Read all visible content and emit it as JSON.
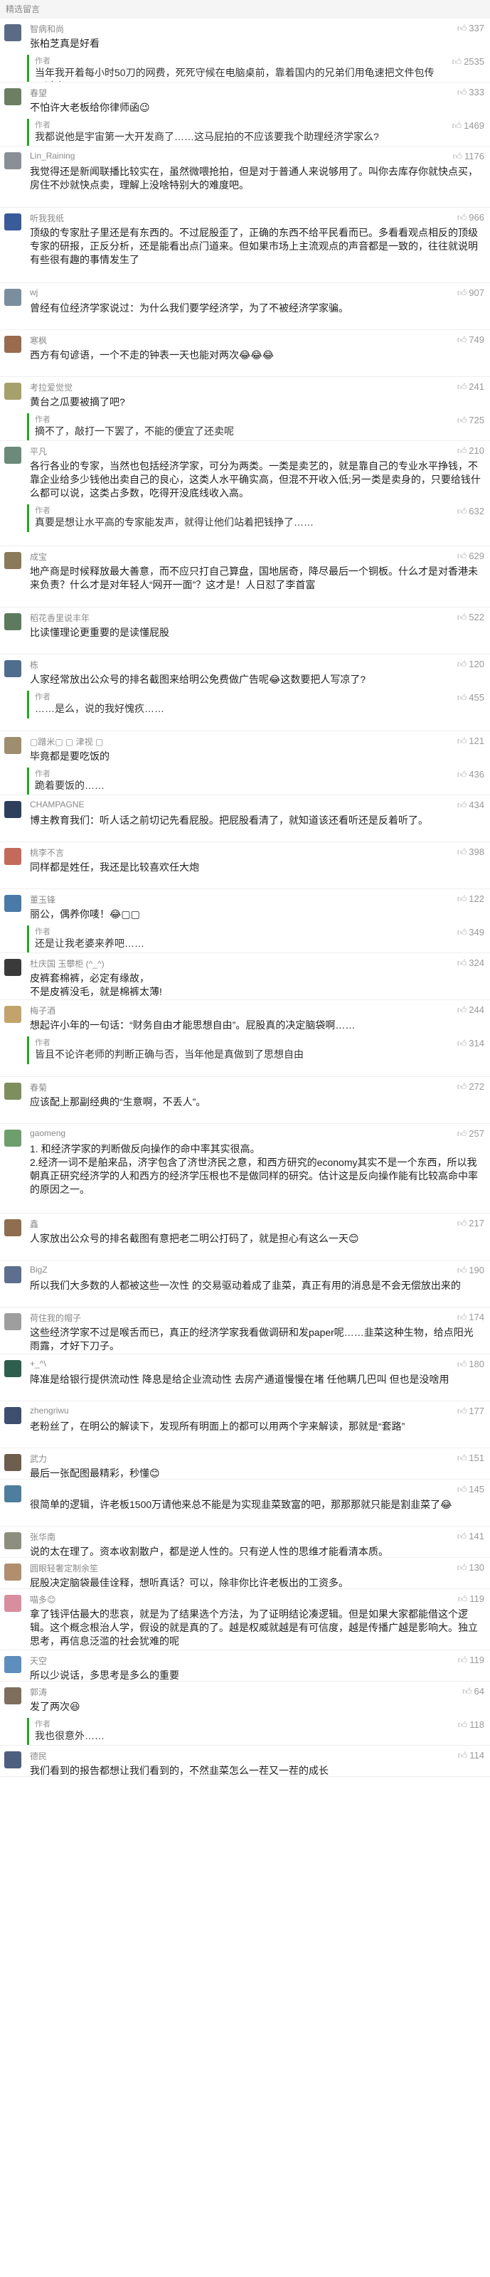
{
  "header": {
    "title": "精选留言"
  },
  "comments": [
    {
      "user": "智病和尚",
      "avatar_color": "#5b6b85",
      "likes": "337",
      "text": "张柏芝真是好看",
      "reply": {
        "label": "作者",
        "text": "当年我开着每小时50刀的网费，死死守候在电脑桌前，靠着国内的兄弟们用龟速把文件包传了过来……",
        "likes": "2535"
      }
    },
    {
      "user": "春望",
      "avatar_color": "#6d7f63",
      "likes": "333",
      "text": "不怕许大老板给你律师函😉",
      "reply": {
        "label": "作者",
        "text": "我都说他是宇宙第一大开发商了……这马屁拍的不应该要我个助理经济学家么?",
        "likes": "1469"
      }
    },
    {
      "user": "Lin_Raining",
      "avatar_color": "#8a8f96",
      "likes": "1176",
      "text": "我觉得还是新闻联播比较实在，虽然微喂抢拍，但是对于普通人来说够用了。叫你去库存你就快点买，房住不炒就快点卖，理解上没啥特别大的难度吧。"
    },
    {
      "user": "听我我纸",
      "avatar_color": "#3a5b9a",
      "likes": "966",
      "text": "顶级的专家肚子里还是有东西的。不过屁股歪了，正确的东西不给平民看而已。多看看观点相反的顶级专家的研报，正反分析，还是能看出点门道来。但如果市场上主流观点的声音都是一致的，往往就说明有些很有趣的事情发生了"
    },
    {
      "user": "wj",
      "avatar_color": "#7a8e9e",
      "likes": "907",
      "text": "曾经有位经济学家说过：为什么我们要学经济学，为了不被经济学家骗。"
    },
    {
      "user": "寒枫",
      "avatar_color": "#9a6b4f",
      "likes": "749",
      "text": "西方有句谚语，一个不走的钟表一天也能对两次😂😂😂"
    },
    {
      "user": "考拉爱觉觉",
      "avatar_color": "#a6a06b",
      "likes": "241",
      "text": "黄台之瓜要被摘了吧?",
      "reply": {
        "label": "作者",
        "text": "摘不了，敲打一下罢了，不能的便宜了还卖呢",
        "likes": "725"
      }
    },
    {
      "user": "平凡",
      "avatar_color": "#6b8a7a",
      "likes": "210",
      "text": "各行各业的专家，当然也包括经济学家，可分为两类。一类是卖艺的，就是靠自己的专业水平挣钱，不靠企业给多少钱他出卖自己的良心，这类人水平确实高，但混不开收入低;另一类是卖身的，只要给钱什么都可以说，这类占多数，吃得开没底线收入高。",
      "reply": {
        "label": "作者",
        "text": "真要是想让水平高的专家能发声，就得让他们站着把钱挣了……",
        "likes": "632"
      }
    },
    {
      "user": "成宝",
      "avatar_color": "#8a7a5a",
      "likes": "629",
      "text": "地产商是时候释放最大善意，而不应只打自己算盘，国地居奇，降尽最后一个铜板。什么才是对香港未来负责？什么才是对年轻人“网开一面”？这才是！人日怼了李首富"
    },
    {
      "user": "稻花香里说丰年",
      "avatar_color": "#5e7a5e",
      "likes": "522",
      "text": "比读懂理论更重要的是读懂屁股"
    },
    {
      "user": "栋",
      "avatar_color": "#4f6e8e",
      "likes": "120",
      "text": "人家经常放出公众号的排名截图来给明公免费做广告呢😂这数要把人写凉了?",
      "reply": {
        "label": "作者",
        "text": "……是么，说的我好愧疚……",
        "likes": "455"
      }
    },
    {
      "user": "▢蹭米▢ ▢ 津视 ▢",
      "avatar_color": "#9e8e6e",
      "likes": "121",
      "text": "毕竟都是要吃饭的",
      "reply": {
        "label": "作者",
        "text": "跪着要饭的……",
        "likes": "436"
      }
    },
    {
      "user": "CHAMPAGNE",
      "avatar_color": "#2e3f5e",
      "likes": "434",
      "text": "博主教育我们：听人话之前切记先看屁股。把屁股看清了，就知道该还看听还是反着听了。"
    },
    {
      "user": "桃李不言",
      "avatar_color": "#c46a5a",
      "likes": "398",
      "text": "同样都是姓任，我还是比较喜欢任大炮"
    },
    {
      "user": "董玉锋",
      "avatar_color": "#4a7aa8",
      "likes": "122",
      "text": "丽公，偶养你唛！😂▢▢",
      "reply": {
        "label": "作者",
        "text": "还是让我老婆来养吧……",
        "likes": "349"
      }
    },
    {
      "user": "杜庆国 玉攀柜 (^_^)",
      "avatar_color": "#3a3a3a",
      "likes": "324",
      "text": "皮裤套棉裤，必定有缘故，\n不是皮裤没毛，就是棉裤太薄!"
    },
    {
      "user": "梅子酒",
      "avatar_color": "#c2a36b",
      "likes": "244",
      "text": "想起许小年的一句话：“财务自由才能思想自由”。屁股真的决定脑袋啊……",
      "reply": {
        "label": "作者",
        "text": "皆且不论许老师的判断正确与否，当年他是真做到了思想自由",
        "likes": "314"
      }
    },
    {
      "user": "春菊",
      "avatar_color": "#7e8e5e",
      "likes": "272",
      "text": "应该配上那副经典的“生意啊，不丢人”。"
    },
    {
      "user": "gaomeng",
      "avatar_color": "#6e9e6e",
      "likes": "257",
      "text": "1. 和经济学家的判断做反向操作的命中率其实很高。\n2.经济一词不是舶来品，济字包含了济世济民之意，和西方研究的economy其实不是一个东西，所以我朝真正研究经济学的人和西方的经济学压根也不是做同样的研究。估计这是反向操作能有比较高命中率的原因之一。"
    },
    {
      "user": "鑫",
      "avatar_color": "#8e6e4e",
      "likes": "217",
      "text": "人家放出公众号的排名截图有意把老二明公打码了，就是担心有这么一天😊"
    },
    {
      "user": "BigZ",
      "avatar_color": "#5e6e8e",
      "likes": "190",
      "text": "所以我们大多数的人都被这些一次性 的交易驱动着成了韭菜，真正有用的消息是不会无偿放出来的"
    },
    {
      "user": "荷住我的帽子",
      "avatar_color": "#9e9e9e",
      "likes": "174",
      "text": "这些经济学家不过是喉舌而已，真正的经济学家我看做调研和发paper呢……韭菜这种生物，给点阳光雨露，才好下刀子。"
    },
    {
      "user": "+_^\\",
      "avatar_color": "#2e5e4e",
      "likes": "180",
      "text": "降准是给银行提供流动性 降息是给企业流动性 去房产通道慢慢在堵 任他瞒几巴叫 但也是没啥用"
    },
    {
      "user": "zhengriwu",
      "avatar_color": "#3e4e6e",
      "likes": "177",
      "text": "老粉丝了，在明公的解读下，发现所有明面上的都可以用两个字来解读，那就是“套路”"
    },
    {
      "user": "武力",
      "avatar_color": "#6e5e4e",
      "likes": "151",
      "text": "最后一张配图最精彩，秒懂😊"
    },
    {
      "user": "",
      "avatar_color": "#4e7e9e",
      "likes": "145",
      "text": "很简单的逻辑，许老板1500万请他来总不能是为实现韭菜致富的吧，那那那就只能是割韭菜了😂"
    },
    {
      "user": "张华南",
      "avatar_color": "#8e8e7e",
      "likes": "141",
      "text": "说的太在理了。资本收割散户，都是逆人性的。只有逆人性的思维才能看清本质。"
    },
    {
      "user": "圆眼轻奢定制余笙",
      "avatar_color": "#b08e6e",
      "likes": "130",
      "text": "屁股决定脑袋最佳诠释，想听真话？可以，除非你比许老板出的工资多。"
    },
    {
      "user": "喵多😊",
      "avatar_color": "#d88e9e",
      "likes": "119",
      "text": "拿了钱评估最大的悲哀，就是为了结果选个方法，为了证明结论凑逻辑。但是如果大家都能借这个逻辑。这个概念根治人学，假设的就是真的了。越是权威就越是有可信度，越是传播广越是影响大。独立思考，再信息泛滥的社会犹难的呢"
    },
    {
      "user": "天空",
      "avatar_color": "#5e8ebe",
      "likes": "119",
      "text": "所以少说话，多思考是多么的重要"
    },
    {
      "user": "郭涛",
      "avatar_color": "#7e6e5e",
      "likes": "64",
      "text": "发了两次😆",
      "reply": {
        "label": "作者",
        "text": "我也很意外……",
        "likes": "118"
      }
    },
    {
      "user": "德民",
      "avatar_color": "#4e5e7e",
      "likes": "114",
      "text": "我们看到的报告都想让我们看到的，不然韭菜怎么一茬又一茬的成长"
    }
  ]
}
